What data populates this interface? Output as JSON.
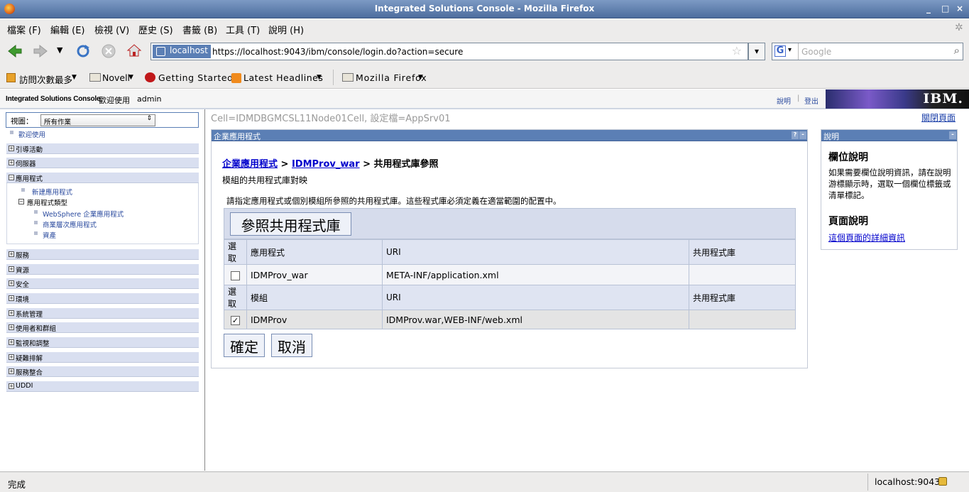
{
  "window": {
    "title": "Integrated Solutions Console - Mozilla Firefox",
    "controls": [
      "_",
      "□",
      "×"
    ]
  },
  "menu": [
    "檔案 (F)",
    "編輯 (E)",
    "檢視 (V)",
    "歷史 (S)",
    "書籤 (B)",
    "工具 (T)",
    "說明 (H)"
  ],
  "nav": {
    "site": "localhost",
    "url": "https://localhost:9043/ibm/console/login.do?action=secure",
    "search_placeholder": "Google"
  },
  "bookmarks": [
    "訪問次數最多",
    "Novell",
    "Getting Started",
    "Latest Headlines",
    "Mozilla Firefox"
  ],
  "header": {
    "console": "Integrated Solutions Console",
    "welcome": "歡迎使用",
    "user": "admin",
    "help": "說明",
    "logout": "登出",
    "logo": "IBM."
  },
  "sidebar": {
    "view_label": "視圖：",
    "view_value": "所有作業",
    "welcome": "歡迎使用",
    "items": [
      "引導活動",
      "伺服器",
      "應用程式",
      "服務",
      "資源",
      "安全",
      "環境",
      "系統管理",
      "使用者和群組",
      "監視和調整",
      "疑難排解",
      "服務整合",
      "UDDI"
    ],
    "apps_sub": {
      "new_app": "新建應用程式",
      "app_types": "應用程式類型",
      "types": [
        "WebSphere 企業應用程式",
        "商業層次應用程式",
        "資產"
      ]
    }
  },
  "main": {
    "scope": "Cell=IDMDBGMCSL11Node01Cell, 設定檔=AppSrv01",
    "close_page": "關閉頁面",
    "panel_title": "企業應用程式",
    "panel_icons": [
      "?",
      "-"
    ],
    "breadcrumb": {
      "link1": "企業應用程式",
      "sep": " > ",
      "link2": "IDMProv_war",
      "current": " > 共用程式庫參照"
    },
    "subtitle": "模組的共用程式庫對映",
    "instruction": "請指定應用程式或個別模組所參照的共用程式庫。這些程式庫必須定義在適當範圍的配置中。",
    "ref_button": "參照共用程式庫",
    "table1": {
      "headers": [
        "選取",
        "應用程式",
        "URI",
        "共用程式庫"
      ],
      "row": {
        "checked": false,
        "name": "IDMProv_war",
        "uri": "META-INF/application.xml",
        "lib": ""
      }
    },
    "table2": {
      "headers": [
        "選取",
        "模組",
        "URI",
        "共用程式庫"
      ],
      "row": {
        "checked": true,
        "name": "IDMProv",
        "uri": "IDMProv.war,WEB-INF/web.xml",
        "lib": ""
      }
    },
    "ok": "確定",
    "cancel": "取消"
  },
  "help_panel": {
    "title": "說明",
    "field_help_title": "欄位說明",
    "field_help_text": "如果需要欄位說明資訊，請在說明游標顯示時，選取一個欄位標籤或清單標記。",
    "page_help_title": "頁面說明",
    "page_help_link": "這個頁面的詳細資訊"
  },
  "status": {
    "text": "完成",
    "host": "localhost:9043"
  }
}
